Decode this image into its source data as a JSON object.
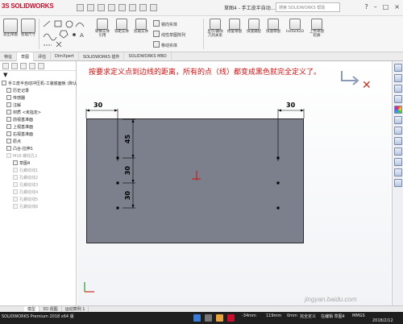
{
  "app": {
    "logo_text": "SOLIDWORKS",
    "doc_title": "草图4 - 手工皮半自动…",
    "search_placeholder": "搜索 SOLIDWORKS 帮助",
    "window_buttons": [
      "?",
      "–",
      "□",
      "×"
    ]
  },
  "ribbon": {
    "buttons": [
      {
        "label": "退出草图",
        "name": "exit-sketch-button"
      },
      {
        "label": "智能尺寸",
        "name": "smart-dimension-button"
      },
      {
        "label": "镜向实体",
        "name": "mirror-entities-button"
      },
      {
        "label": "线性草图阵列",
        "name": "linear-sketch-pattern-button"
      },
      {
        "label": "移动实体",
        "name": "move-entities-button"
      },
      {
        "label": "显示/删除几何关系",
        "name": "display-delete-relations-button"
      },
      {
        "label": "修复草图",
        "name": "repair-sketch-button"
      },
      {
        "label": "快速捕捉",
        "name": "quick-snaps-button"
      },
      {
        "label": "快速草图",
        "name": "rapid-sketch-button"
      },
      {
        "label": "Instant2D",
        "name": "instant2d-button"
      },
      {
        "label": "上色草图轮廓",
        "name": "shaded-sketch-contours-button"
      }
    ],
    "mini_items": [
      "镜向实体",
      "线性草图阵列",
      "移动实体"
    ],
    "small_labels": [
      "转换实体引用",
      "等距实体",
      "剪裁实体"
    ]
  },
  "tabs": [
    "特征",
    "草图",
    "评估",
    "DimXpert",
    "SOLIDWORKS 插件",
    "SOLIDWORKS MBD"
  ],
  "active_tab": 1,
  "tree": {
    "items": [
      {
        "label": "手工皮半自动冲压机-工装底面板 (默认<",
        "level": 0
      },
      {
        "label": "历史记录",
        "level": 1
      },
      {
        "label": "传感器",
        "level": 1
      },
      {
        "label": "注解",
        "level": 1
      },
      {
        "label": "材质 <未指定>",
        "level": 1
      },
      {
        "label": "前视基准面",
        "level": 1
      },
      {
        "label": "上视基准面",
        "level": 1
      },
      {
        "label": "右视基准面",
        "level": 1
      },
      {
        "label": "原点",
        "level": 1
      },
      {
        "label": "凸台-拉伸1",
        "level": 1
      },
      {
        "label": "M16 螺纹孔1",
        "level": 1,
        "dim": true
      },
      {
        "label": "草图4",
        "level": 2
      },
      {
        "label": "孔螺纹线1",
        "level": 2,
        "dim": true
      },
      {
        "label": "孔螺纹线2",
        "level": 2,
        "dim": true
      },
      {
        "label": "孔螺纹线3",
        "level": 2,
        "dim": true
      },
      {
        "label": "孔螺纹线4",
        "level": 2,
        "dim": true
      },
      {
        "label": "孔螺纹线5",
        "level": 2,
        "dim": true
      },
      {
        "label": "孔螺纹线6",
        "level": 2,
        "dim": true
      }
    ]
  },
  "viewport": {
    "instruction": "按要求定义点到边线的距离，所有的点（线）都变成黑色就完全定义了。",
    "dimensions": {
      "top_left": "30",
      "top_right": "30",
      "vertical_upper": "45",
      "vertical_middle": "30",
      "vertical_lower": "30"
    },
    "watermark": "jingyan.baidu.com"
  },
  "bottom_tabs": [
    "模型",
    "3D 视图",
    "运动算例 1"
  ],
  "active_bottom_tab": 0,
  "status": {
    "left": "SOLIDWORKS Premium 2018 x64 版",
    "coord1": "-34mm",
    "coord2": "119mm",
    "coord3": "0mm",
    "state": "完全定义",
    "editing": "在编辑 草图4",
    "units": "MMGS",
    "date": "2018/2/12"
  },
  "colors": {
    "brand_red": "#c8102e",
    "instruction_red": "#d01010",
    "plate_gray": "#7c808c"
  }
}
